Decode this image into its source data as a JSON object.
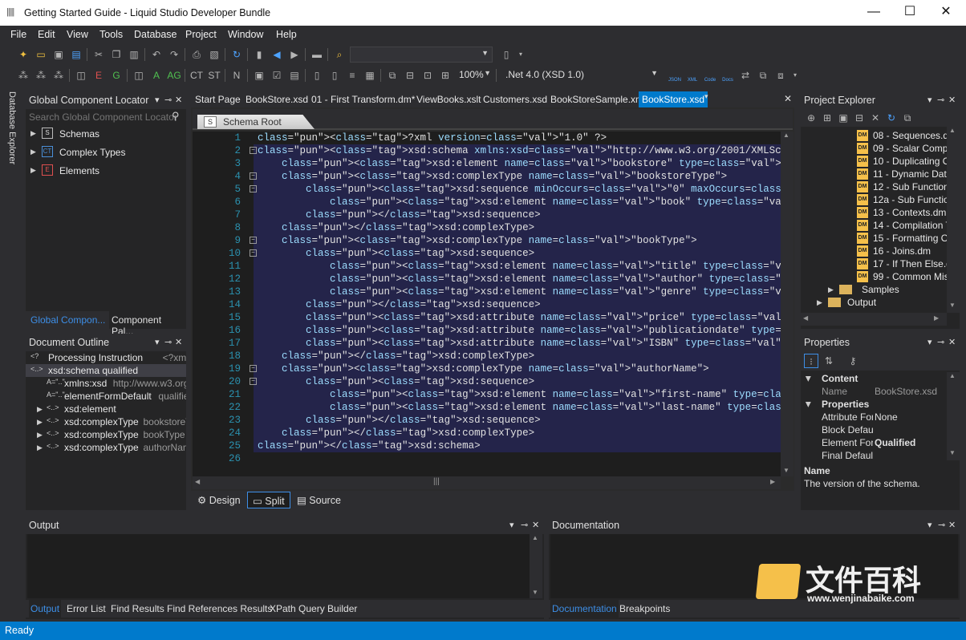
{
  "window": {
    "title": "Getting Started Guide - Liquid Studio Developer Bundle",
    "minimize": "—",
    "maximize": "☐",
    "close": "✕"
  },
  "menu": [
    "File",
    "Edit",
    "View",
    "Tools",
    "Database",
    "Project",
    "Window",
    "Help"
  ],
  "toolbar": {
    "zoom": "100%",
    "target": ".Net 4.0 (XSD 1.0)",
    "btn_json": "JSON",
    "btn_xml": "XML",
    "btn_code": "Code",
    "btn_docs": "Docs"
  },
  "db_explorer": {
    "label": "Database Explorer"
  },
  "gcl": {
    "title": "Global Component Locator",
    "search_placeholder": "Search Global Component Locator",
    "items": [
      "Schemas",
      "Complex Types",
      "Elements"
    ],
    "item_icons": [
      "S",
      "CT",
      "E"
    ],
    "tab1": "Global Compon...",
    "tab2": "Component Pal..."
  },
  "outline": {
    "title": "Document Outline",
    "rows": [
      {
        "icon": "<?",
        "name": "Processing Instruction",
        "detail": "<?xml version"
      },
      {
        "icon": "<..>",
        "name": "xsd:schema qualified",
        "detail": ""
      },
      {
        "icon": "A=\"..\"",
        "name": "xmlns:xsd",
        "detail": "http://www.w3.org/20"
      },
      {
        "icon": "A=\"..\"",
        "name": "elementFormDefault",
        "detail": "qualified"
      },
      {
        "icon": "<..>",
        "name": "xsd:element",
        "detail": ""
      },
      {
        "icon": "<..>",
        "name": "xsd:complexType",
        "detail": "bookstoreTyp"
      },
      {
        "icon": "<..>",
        "name": "xsd:complexType",
        "detail": "bookType"
      },
      {
        "icon": "<..>",
        "name": "xsd:complexType",
        "detail": "authorName"
      }
    ]
  },
  "doc_tabs": [
    "Start Page",
    "BookStore.xsd",
    "01 - First Transform.dm*",
    "ViewBooks.xslt",
    "Customers.xsd",
    "BookStoreSample.xml",
    "BookStore.xsd"
  ],
  "schema_root": {
    "icon": "S",
    "label": "Schema Root"
  },
  "code_lines": [
    "<?xml version=\"1.0\" ?>",
    "<xsd:schema xmlns:xsd=\"http://www.w3.org/2001/XMLSchema\" elementFormDefault=\"qualif",
    "    <xsd:element name=\"bookstore\" type=\"bookstoreType\" />",
    "    <xsd:complexType name=\"bookstoreType\">",
    "        <xsd:sequence minOccurs=\"0\" maxOccurs=\"unbounded\">",
    "            <xsd:element name=\"book\" type=\"bookType\" />",
    "        </xsd:sequence>",
    "    </xsd:complexType>",
    "    <xsd:complexType name=\"bookType\">",
    "        <xsd:sequence>",
    "            <xsd:element name=\"title\" type=\"xsd:string\" />",
    "            <xsd:element name=\"author\" type=\"authorName\" />",
    "            <xsd:element name=\"genre\" type=\"xsd:string\" minOccurs=\"0\" />",
    "        </xsd:sequence>",
    "        <xsd:attribute name=\"price\" type=\"xsd:double\" use=\"required\" />",
    "        <xsd:attribute name=\"publicationdate\" type=\"xsd:date\" />",
    "        <xsd:attribute name=\"ISBN\" type=\"xsd:string\" />",
    "    </xsd:complexType>",
    "    <xsd:complexType name=\"authorName\">",
    "        <xsd:sequence>",
    "            <xsd:element name=\"first-name\" type=\"xsd:string\" />",
    "            <xsd:element name=\"last-name\" type=\"xsd:string\" />",
    "        </xsd:sequence>",
    "    </xsd:complexType>",
    "</xsd:schema>",
    ""
  ],
  "line_numbers": [
    "1",
    "2",
    "3",
    "4",
    "5",
    "6",
    "7",
    "8",
    "9",
    "10",
    "11",
    "12",
    "13",
    "14",
    "15",
    "16",
    "17",
    "18",
    "19",
    "20",
    "21",
    "22",
    "23",
    "24",
    "25",
    "26"
  ],
  "fold_lines": [
    2,
    4,
    5,
    9,
    10,
    19,
    20
  ],
  "view_tabs": [
    "Design",
    "Split",
    "Source"
  ],
  "project_explorer": {
    "title": "Project Explorer",
    "files": [
      "08 - Sequences.dm",
      "09 - Scalar Compor",
      "10 - Duplicating Ou",
      "11 - Dynamic Data",
      "12 - Sub Functions",
      "12a - Sub Function",
      "13 - Contexts.dm",
      "14 - Compilation Tr",
      "15 - Formatting Out",
      "16 - Joins.dm",
      "17 - If Then Else.dm",
      "99 - Common Mista"
    ],
    "file_icon": "DM",
    "folders": [
      "Samples",
      "Output"
    ]
  },
  "properties": {
    "title": "Properties",
    "cat_content": "Content",
    "name_key": "Name",
    "name_val": "BookStore.xsd",
    "cat_props": "Properties",
    "rows": [
      {
        "k": "Attribute Form",
        "v": "None"
      },
      {
        "k": "Block Default",
        "v": ""
      },
      {
        "k": "Element Form",
        "v": "Qualified"
      },
      {
        "k": "Final Default",
        "v": ""
      }
    ],
    "desc_title": "Name",
    "desc_text": "The version of the schema."
  },
  "output": {
    "title": "Output",
    "tabs": [
      "Output",
      "Error List",
      "Find Results",
      "Find References Results",
      "XPath Query Builder"
    ]
  },
  "documentation": {
    "title": "Documentation",
    "tabs": [
      "Documentation",
      "Breakpoints"
    ]
  },
  "status": "Ready",
  "watermark": {
    "cn": "文件百科",
    "url": "www.wenjinabaike.com"
  }
}
